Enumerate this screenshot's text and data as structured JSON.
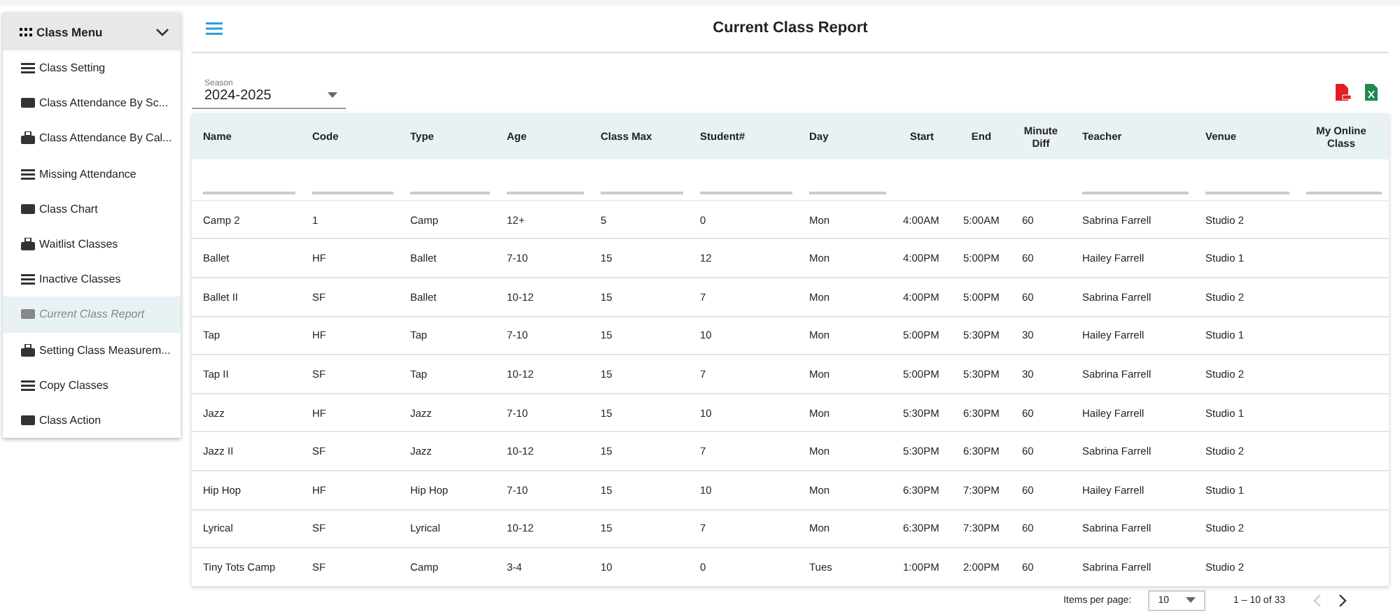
{
  "sidebar": {
    "title": "Class Menu",
    "expanded": true,
    "items": [
      {
        "label": "Class Setting",
        "selected": false
      },
      {
        "label": "Class Attendance By Sc...",
        "selected": false
      },
      {
        "label": "Class Attendance By Cal...",
        "selected": false
      },
      {
        "label": "Missing Attendance",
        "selected": false
      },
      {
        "label": "Class Chart",
        "selected": false
      },
      {
        "label": "Waitlist Classes",
        "selected": false
      },
      {
        "label": "Inactive Classes",
        "selected": false
      },
      {
        "label": "Current Class Report",
        "selected": true
      },
      {
        "label": "Setting Class Measurem...",
        "selected": false
      },
      {
        "label": "Copy Classes",
        "selected": false
      },
      {
        "label": "Class Action",
        "selected": false
      }
    ]
  },
  "header": {
    "title": "Current Class Report"
  },
  "season": {
    "label": "Season",
    "value": "2024-2025"
  },
  "table": {
    "columns": [
      {
        "label": "Name",
        "kind": "filterable"
      },
      {
        "label": "Code",
        "kind": "filterable"
      },
      {
        "label": "Type",
        "kind": "filterable"
      },
      {
        "label": "Age",
        "kind": "filterable"
      },
      {
        "label": "Class Max",
        "kind": "filterable"
      },
      {
        "label": "Student#",
        "kind": "filterable"
      },
      {
        "label": "Day",
        "kind": "filterable"
      },
      {
        "label": "Start",
        "kind": "plain"
      },
      {
        "label": "End",
        "kind": "plain"
      },
      {
        "label": "Minute Diff",
        "kind": "plain"
      },
      {
        "label": "Teacher",
        "kind": "filterable"
      },
      {
        "label": "Venue",
        "kind": "filterable"
      },
      {
        "label": "My Online Class",
        "kind": "filterable"
      }
    ],
    "rows": [
      [
        "Camp 2",
        "1",
        "Camp",
        "12+",
        "5",
        "0",
        "Mon",
        "4:00AM",
        "5:00AM",
        "60",
        "Sabrina Farrell",
        "Studio 2",
        ""
      ],
      [
        "Ballet",
        "HF",
        "Ballet",
        "7-10",
        "15",
        "12",
        "Mon",
        "4:00PM",
        "5:00PM",
        "60",
        "Hailey Farrell",
        "Studio 1",
        ""
      ],
      [
        "Ballet II",
        "SF",
        "Ballet",
        "10-12",
        "15",
        "7",
        "Mon",
        "4:00PM",
        "5:00PM",
        "60",
        "Sabrina Farrell",
        "Studio 2",
        ""
      ],
      [
        "Tap",
        "HF",
        "Tap",
        "7-10",
        "15",
        "10",
        "Mon",
        "5:00PM",
        "5:30PM",
        "30",
        "Hailey Farrell",
        "Studio 1",
        ""
      ],
      [
        "Tap II",
        "SF",
        "Tap",
        "10-12",
        "15",
        "7",
        "Mon",
        "5:00PM",
        "5:30PM",
        "30",
        "Sabrina Farrell",
        "Studio 2",
        ""
      ],
      [
        "Jazz",
        "HF",
        "Jazz",
        "7-10",
        "15",
        "10",
        "Mon",
        "5:30PM",
        "6:30PM",
        "60",
        "Hailey Farrell",
        "Studio 1",
        ""
      ],
      [
        "Jazz II",
        "SF",
        "Jazz",
        "10-12",
        "15",
        "7",
        "Mon",
        "5:30PM",
        "6:30PM",
        "60",
        "Sabrina Farrell",
        "Studio 2",
        ""
      ],
      [
        "Hip Hop",
        "HF",
        "Hip Hop",
        "7-10",
        "15",
        "10",
        "Mon",
        "6:30PM",
        "7:30PM",
        "60",
        "Hailey Farrell",
        "Studio 1",
        ""
      ],
      [
        "Lyrical",
        "SF",
        "Lyrical",
        "10-12",
        "15",
        "7",
        "Mon",
        "6:30PM",
        "7:30PM",
        "60",
        "Sabrina Farrell",
        "Studio 2",
        ""
      ],
      [
        "Tiny Tots Camp",
        "SF",
        "Camp",
        "3-4",
        "10",
        "0",
        "Tues",
        "1:00PM",
        "2:00PM",
        "60",
        "Sabrina Farrell",
        "Studio 2",
        ""
      ]
    ]
  },
  "paginator": {
    "label": "Items per page:",
    "page_size": "10",
    "range": "1 – 10 of 33",
    "prev_disabled": true,
    "next_disabled": false
  }
}
